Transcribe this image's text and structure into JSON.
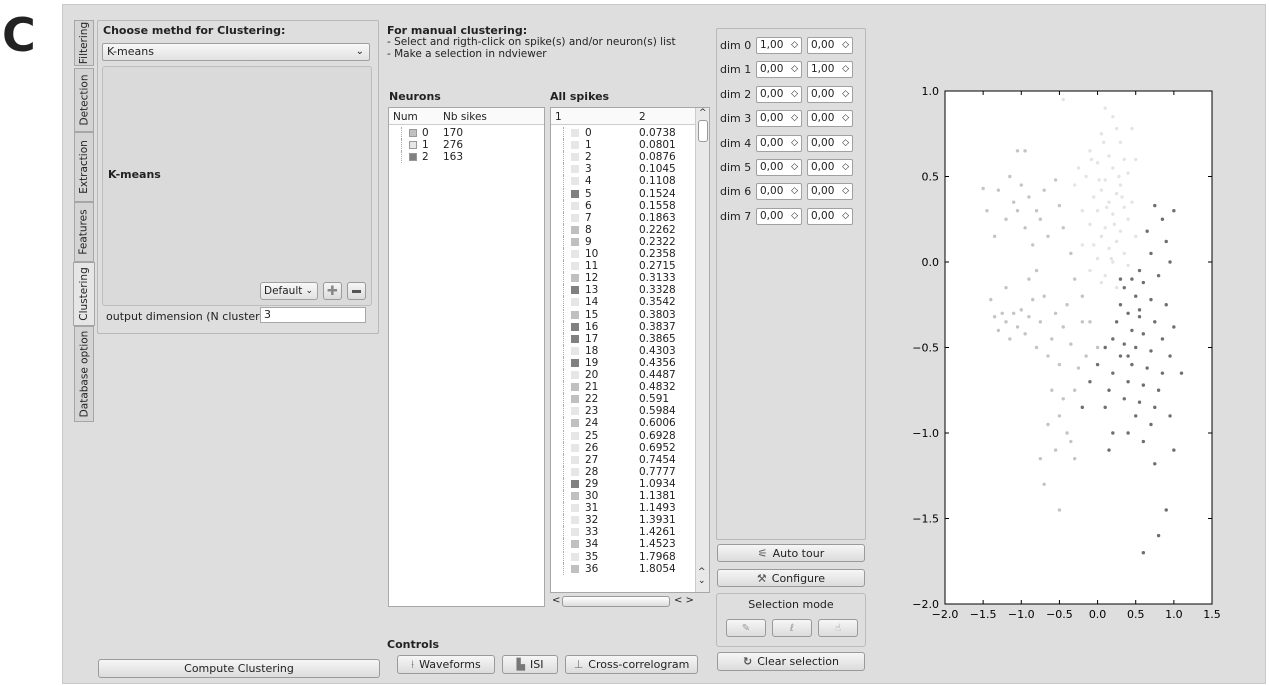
{
  "figure_label": "C",
  "tabs": [
    "Filtering",
    "Detection",
    "Extraction",
    "Features",
    "Clustering",
    "Database option"
  ],
  "method": {
    "label": "Choose methd for Clustering:",
    "selected": "K-means",
    "heading": "K-means",
    "preset": "Default",
    "output_label": "output dimension (N cluster)",
    "output_value": "3",
    "compute": "Compute Clustering"
  },
  "manual": {
    "title": "For manual clustering:",
    "line1": "- Select and rigth-click on spike(s) and/or neuron(s) list",
    "line2": "- Make a selection in ndviewer"
  },
  "neurons": {
    "title": "Neurons",
    "col1": "Num",
    "col2": "Nb sikes",
    "rows": [
      {
        "num": "0",
        "n": "170",
        "color": "#c0c0c0"
      },
      {
        "num": "1",
        "n": "276",
        "color": "#e6e6e6"
      },
      {
        "num": "2",
        "n": "163",
        "color": "#808080"
      }
    ]
  },
  "spikes": {
    "title": "All spikes",
    "col1": "1",
    "col2": "2",
    "ids": [
      "0",
      "1",
      "2",
      "3",
      "4",
      "5",
      "6",
      "7",
      "8",
      "9",
      "10",
      "11",
      "12",
      "13",
      "14",
      "15",
      "16",
      "17",
      "18",
      "19",
      "20",
      "21",
      "22",
      "23",
      "24",
      "25",
      "26",
      "27",
      "28",
      "29",
      "30",
      "31",
      "32",
      "33",
      "34",
      "35",
      "36"
    ],
    "vals": [
      "0.0738",
      "0.0801",
      "0.0876",
      "0.1045",
      "0.1108",
      "0.1524",
      "0.1558",
      "0.1863",
      "0.2262",
      "0.2322",
      "0.2358",
      "0.2715",
      "0.3133",
      "0.3328",
      "0.3542",
      "0.3803",
      "0.3837",
      "0.3865",
      "0.4303",
      "0.4356",
      "0.4487",
      "0.4832",
      "0.591",
      "0.5984",
      "0.6006",
      "0.6928",
      "0.6952",
      "0.7454",
      "0.7777",
      "1.0934",
      "1.1381",
      "1.1493",
      "1.3931",
      "1.4261",
      "1.4523",
      "1.7968",
      "1.8054"
    ],
    "cluster": [
      1,
      1,
      1,
      1,
      1,
      2,
      1,
      1,
      0,
      0,
      1,
      1,
      0,
      2,
      1,
      0,
      2,
      2,
      1,
      2,
      1,
      0,
      0,
      1,
      0,
      1,
      1,
      1,
      1,
      2,
      0,
      1,
      1,
      1,
      0,
      1,
      0
    ]
  },
  "cluster_colors": [
    "#c0c0c0",
    "#e6e6e6",
    "#808080"
  ],
  "controls": {
    "title": "Controls",
    "waveforms": "Waveforms",
    "isi": "ISI",
    "xcorr": "Cross-correlogram"
  },
  "dims": [
    {
      "label": "dim 0",
      "a": "1,00",
      "b": "0,00"
    },
    {
      "label": "dim 1",
      "a": "0,00",
      "b": "1,00"
    },
    {
      "label": "dim 2",
      "a": "0,00",
      "b": "0,00"
    },
    {
      "label": "dim 3",
      "a": "0,00",
      "b": "0,00"
    },
    {
      "label": "dim 4",
      "a": "0,00",
      "b": "0,00"
    },
    {
      "label": "dim 5",
      "a": "0,00",
      "b": "0,00"
    },
    {
      "label": "dim 6",
      "a": "0,00",
      "b": "0,00"
    },
    {
      "label": "dim 7",
      "a": "0,00",
      "b": "0,00"
    }
  ],
  "tour": {
    "auto": "Auto tour",
    "configure": "Configure",
    "selection_mode": "Selection mode",
    "clear": "Clear selection"
  },
  "chart_data": {
    "type": "scatter",
    "xlim": [
      -2.0,
      1.5
    ],
    "ylim": [
      -2.0,
      1.0
    ],
    "xticks": [
      "−2.0",
      "−1.5",
      "−1.0",
      "−0.5",
      "0.0",
      "0.5",
      "1.0",
      "1.5"
    ],
    "yticks": [
      "1.0",
      "0.5",
      "0.0",
      "−0.5",
      "−1.0",
      "−1.5",
      "−2.0"
    ],
    "series": [
      {
        "color": "#c4c4c4",
        "points": [
          [
            -1.5,
            0.43
          ],
          [
            -1.45,
            0.3
          ],
          [
            -1.35,
            0.15
          ],
          [
            -1.3,
            0.42
          ],
          [
            -1.2,
            0.25
          ],
          [
            -1.15,
            0.5
          ],
          [
            -1.1,
            0.35
          ],
          [
            -1.05,
            0.3
          ],
          [
            -1.0,
            0.45
          ],
          [
            -0.95,
            0.2
          ],
          [
            -0.9,
            0.38
          ],
          [
            -0.85,
            0.1
          ],
          [
            -0.8,
            0.3
          ],
          [
            -1.05,
            0.65
          ],
          [
            -0.95,
            0.65
          ],
          [
            -0.75,
            0.25
          ],
          [
            -0.7,
            0.42
          ],
          [
            -0.65,
            0.15
          ],
          [
            -0.55,
            0.48
          ],
          [
            -0.5,
            0.33
          ],
          [
            -0.45,
            0.2
          ],
          [
            -1.4,
            -0.22
          ],
          [
            -1.35,
            -0.32
          ],
          [
            -1.3,
            -0.4
          ],
          [
            -1.25,
            -0.3
          ],
          [
            -1.2,
            -0.35
          ],
          [
            -1.15,
            -0.45
          ],
          [
            -1.1,
            -0.3
          ],
          [
            -1.05,
            -0.38
          ],
          [
            -1.0,
            -0.28
          ],
          [
            -0.95,
            -0.42
          ],
          [
            -0.9,
            -0.32
          ],
          [
            -0.85,
            -0.22
          ],
          [
            -0.8,
            -0.5
          ],
          [
            -0.75,
            -0.35
          ],
          [
            -0.7,
            -0.2
          ],
          [
            -0.65,
            -0.55
          ],
          [
            -0.6,
            -0.45
          ],
          [
            -0.55,
            -0.3
          ],
          [
            -0.5,
            -0.6
          ],
          [
            -0.45,
            -0.38
          ],
          [
            -0.4,
            -0.25
          ],
          [
            -0.35,
            -0.48
          ],
          [
            -0.3,
            -0.75
          ],
          [
            -0.25,
            -0.62
          ],
          [
            -0.2,
            -0.35
          ],
          [
            -0.15,
            -0.55
          ],
          [
            -0.45,
            -0.8
          ],
          [
            -0.5,
            -0.9
          ],
          [
            -0.6,
            -0.75
          ],
          [
            -0.4,
            -1.0
          ],
          [
            -0.3,
            -1.15
          ],
          [
            -0.35,
            -1.05
          ],
          [
            -0.65,
            -0.95
          ],
          [
            -0.55,
            -1.1
          ],
          [
            -0.7,
            -1.3
          ],
          [
            -0.75,
            -1.15
          ],
          [
            -0.5,
            -1.45
          ],
          [
            -1.2,
            -0.15
          ],
          [
            -0.9,
            -0.1
          ],
          [
            -0.3,
            -0.1
          ],
          [
            -0.8,
            -0.05
          ],
          [
            -0.35,
            0.05
          ],
          [
            -0.2,
            -0.2
          ],
          [
            -0.1,
            -0.35
          ],
          [
            0.0,
            -0.5
          ]
        ]
      },
      {
        "color": "#e4e4e4",
        "points": [
          [
            -0.45,
            0.95
          ],
          [
            0.1,
            0.9
          ],
          [
            0.2,
            0.85
          ],
          [
            0.25,
            0.78
          ],
          [
            0.05,
            0.75
          ],
          [
            0.3,
            0.7
          ],
          [
            -0.1,
            0.65
          ],
          [
            0.15,
            0.62
          ],
          [
            0.35,
            0.6
          ],
          [
            0.0,
            0.58
          ],
          [
            0.2,
            0.55
          ],
          [
            0.4,
            0.52
          ],
          [
            -0.15,
            0.5
          ],
          [
            0.1,
            0.48
          ],
          [
            0.3,
            0.45
          ],
          [
            0.05,
            0.42
          ],
          [
            0.25,
            0.4
          ],
          [
            -0.05,
            0.38
          ],
          [
            0.15,
            0.35
          ],
          [
            0.35,
            0.32
          ],
          [
            0.0,
            0.3
          ],
          [
            0.2,
            0.28
          ],
          [
            0.4,
            0.25
          ],
          [
            -0.1,
            0.22
          ],
          [
            0.1,
            0.2
          ],
          [
            0.3,
            0.18
          ],
          [
            0.05,
            0.15
          ],
          [
            0.25,
            0.12
          ],
          [
            -0.05,
            0.1
          ],
          [
            0.15,
            0.08
          ],
          [
            0.35,
            0.05
          ],
          [
            0.0,
            0.02
          ],
          [
            0.2,
            0.0
          ],
          [
            0.4,
            -0.02
          ],
          [
            -0.1,
            -0.05
          ],
          [
            0.1,
            -0.08
          ],
          [
            0.3,
            -0.1
          ],
          [
            0.05,
            -0.12
          ],
          [
            0.25,
            -0.15
          ],
          [
            -0.2,
            0.3
          ],
          [
            -0.25,
            0.55
          ],
          [
            0.45,
            0.35
          ],
          [
            0.5,
            0.15
          ],
          [
            0.5,
            0.6
          ],
          [
            -0.3,
            0.45
          ],
          [
            -0.2,
            0.1
          ],
          [
            0.45,
            0.78
          ],
          [
            0.08,
            0.7
          ],
          [
            0.28,
            0.5
          ],
          [
            0.12,
            0.32
          ],
          [
            0.22,
            0.22
          ],
          [
            0.02,
            0.48
          ],
          [
            0.32,
            0.38
          ],
          [
            0.18,
            0.02
          ],
          [
            -0.08,
            0.6
          ]
        ]
      },
      {
        "color": "#6f6f6f",
        "points": [
          [
            0.75,
            0.33
          ],
          [
            0.85,
            0.25
          ],
          [
            1.0,
            0.3
          ],
          [
            0.65,
            0.18
          ],
          [
            0.9,
            0.12
          ],
          [
            0.7,
            0.05
          ],
          [
            0.95,
            0.0
          ],
          [
            0.55,
            -0.05
          ],
          [
            0.8,
            -0.08
          ],
          [
            0.45,
            -0.1
          ],
          [
            0.6,
            -0.12
          ],
          [
            0.35,
            -0.15
          ],
          [
            0.5,
            -0.2
          ],
          [
            0.7,
            -0.22
          ],
          [
            0.9,
            -0.25
          ],
          [
            0.3,
            -0.25
          ],
          [
            0.4,
            -0.3
          ],
          [
            0.55,
            -0.32
          ],
          [
            0.75,
            -0.35
          ],
          [
            1.0,
            -0.38
          ],
          [
            0.25,
            -0.35
          ],
          [
            0.45,
            -0.4
          ],
          [
            0.6,
            -0.42
          ],
          [
            0.85,
            -0.45
          ],
          [
            0.2,
            -0.45
          ],
          [
            0.35,
            -0.48
          ],
          [
            0.5,
            -0.5
          ],
          [
            0.7,
            -0.52
          ],
          [
            0.95,
            -0.55
          ],
          [
            0.1,
            -0.5
          ],
          [
            0.3,
            -0.55
          ],
          [
            0.45,
            -0.6
          ],
          [
            0.65,
            -0.62
          ],
          [
            0.85,
            -0.65
          ],
          [
            1.1,
            -0.65
          ],
          [
            0.0,
            -0.6
          ],
          [
            0.2,
            -0.65
          ],
          [
            0.4,
            -0.7
          ],
          [
            0.6,
            -0.72
          ],
          [
            0.8,
            -0.75
          ],
          [
            0.15,
            -0.75
          ],
          [
            0.35,
            -0.8
          ],
          [
            0.55,
            -0.82
          ],
          [
            0.75,
            -0.85
          ],
          [
            -0.1,
            -0.7
          ],
          [
            0.1,
            -0.85
          ],
          [
            0.5,
            -0.9
          ],
          [
            0.7,
            -0.95
          ],
          [
            0.95,
            -0.9
          ],
          [
            0.2,
            -1.0
          ],
          [
            0.4,
            -1.0
          ],
          [
            0.6,
            -1.05
          ],
          [
            0.15,
            -1.1
          ],
          [
            0.75,
            -1.18
          ],
          [
            1.0,
            -1.1
          ],
          [
            0.9,
            -1.45
          ],
          [
            0.8,
            -1.6
          ],
          [
            0.6,
            -1.7
          ],
          [
            -0.2,
            -0.85
          ],
          [
            0.3,
            -0.1
          ],
          [
            0.55,
            -0.28
          ],
          [
            0.4,
            -0.55
          ]
        ]
      }
    ]
  }
}
